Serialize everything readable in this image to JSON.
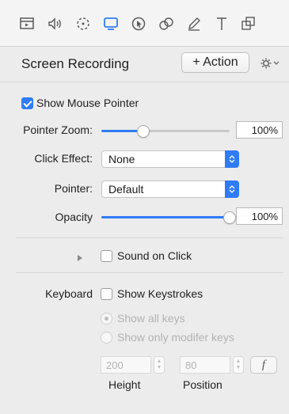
{
  "toolbar": {
    "icons": [
      "video-clip-icon",
      "audio-icon",
      "animation-icon",
      "screen-recording-icon",
      "cursor-icon",
      "transitions-icon",
      "annotation-icon",
      "text-icon",
      "layers-icon"
    ],
    "active_index": 3,
    "active_color": "#2f7cf6"
  },
  "header": {
    "title": "Screen Recording",
    "action_label": "+ Action"
  },
  "show_mouse_pointer": {
    "label": "Show Mouse Pointer",
    "checked": true
  },
  "pointer_zoom": {
    "label": "Pointer Zoom:",
    "value": "100%",
    "level": 0.33
  },
  "click_effect": {
    "label": "Click Effect:",
    "value": "None"
  },
  "pointer": {
    "label": "Pointer:",
    "value": "Default"
  },
  "opacity": {
    "label": "Opacity",
    "value": "100%",
    "level": 1.0
  },
  "sound_on_click": {
    "label": "Sound on Click",
    "checked": false
  },
  "keyboard": {
    "label": "Keyboard",
    "show_keystrokes": {
      "label": "Show Keystrokes",
      "checked": false
    },
    "show_all_keys": "Show all keys",
    "show_modifier_keys": "Show only modifer keys",
    "height": {
      "value": "200",
      "label": "Height"
    },
    "position": {
      "value": "80",
      "label": "Position"
    },
    "font_button": "f"
  },
  "colors": {
    "accent": "#2f7cf6",
    "background": "#ececec"
  }
}
